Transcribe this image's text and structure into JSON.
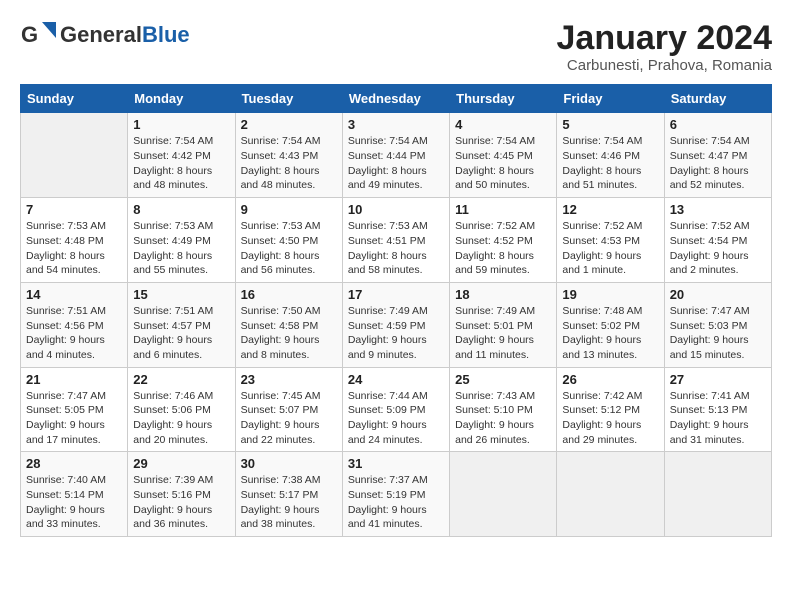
{
  "logo": {
    "line1": "General",
    "line2": "Blue",
    "tagline": ""
  },
  "title": "January 2024",
  "subtitle": "Carbunesti, Prahova, Romania",
  "days_header": [
    "Sunday",
    "Monday",
    "Tuesday",
    "Wednesday",
    "Thursday",
    "Friday",
    "Saturday"
  ],
  "weeks": [
    [
      {
        "num": "",
        "info": ""
      },
      {
        "num": "1",
        "info": "Sunrise: 7:54 AM\nSunset: 4:42 PM\nDaylight: 8 hours\nand 48 minutes."
      },
      {
        "num": "2",
        "info": "Sunrise: 7:54 AM\nSunset: 4:43 PM\nDaylight: 8 hours\nand 48 minutes."
      },
      {
        "num": "3",
        "info": "Sunrise: 7:54 AM\nSunset: 4:44 PM\nDaylight: 8 hours\nand 49 minutes."
      },
      {
        "num": "4",
        "info": "Sunrise: 7:54 AM\nSunset: 4:45 PM\nDaylight: 8 hours\nand 50 minutes."
      },
      {
        "num": "5",
        "info": "Sunrise: 7:54 AM\nSunset: 4:46 PM\nDaylight: 8 hours\nand 51 minutes."
      },
      {
        "num": "6",
        "info": "Sunrise: 7:54 AM\nSunset: 4:47 PM\nDaylight: 8 hours\nand 52 minutes."
      }
    ],
    [
      {
        "num": "7",
        "info": "Sunrise: 7:53 AM\nSunset: 4:48 PM\nDaylight: 8 hours\nand 54 minutes."
      },
      {
        "num": "8",
        "info": "Sunrise: 7:53 AM\nSunset: 4:49 PM\nDaylight: 8 hours\nand 55 minutes."
      },
      {
        "num": "9",
        "info": "Sunrise: 7:53 AM\nSunset: 4:50 PM\nDaylight: 8 hours\nand 56 minutes."
      },
      {
        "num": "10",
        "info": "Sunrise: 7:53 AM\nSunset: 4:51 PM\nDaylight: 8 hours\nand 58 minutes."
      },
      {
        "num": "11",
        "info": "Sunrise: 7:52 AM\nSunset: 4:52 PM\nDaylight: 8 hours\nand 59 minutes."
      },
      {
        "num": "12",
        "info": "Sunrise: 7:52 AM\nSunset: 4:53 PM\nDaylight: 9 hours\nand 1 minute."
      },
      {
        "num": "13",
        "info": "Sunrise: 7:52 AM\nSunset: 4:54 PM\nDaylight: 9 hours\nand 2 minutes."
      }
    ],
    [
      {
        "num": "14",
        "info": "Sunrise: 7:51 AM\nSunset: 4:56 PM\nDaylight: 9 hours\nand 4 minutes."
      },
      {
        "num": "15",
        "info": "Sunrise: 7:51 AM\nSunset: 4:57 PM\nDaylight: 9 hours\nand 6 minutes."
      },
      {
        "num": "16",
        "info": "Sunrise: 7:50 AM\nSunset: 4:58 PM\nDaylight: 9 hours\nand 8 minutes."
      },
      {
        "num": "17",
        "info": "Sunrise: 7:49 AM\nSunset: 4:59 PM\nDaylight: 9 hours\nand 9 minutes."
      },
      {
        "num": "18",
        "info": "Sunrise: 7:49 AM\nSunset: 5:01 PM\nDaylight: 9 hours\nand 11 minutes."
      },
      {
        "num": "19",
        "info": "Sunrise: 7:48 AM\nSunset: 5:02 PM\nDaylight: 9 hours\nand 13 minutes."
      },
      {
        "num": "20",
        "info": "Sunrise: 7:47 AM\nSunset: 5:03 PM\nDaylight: 9 hours\nand 15 minutes."
      }
    ],
    [
      {
        "num": "21",
        "info": "Sunrise: 7:47 AM\nSunset: 5:05 PM\nDaylight: 9 hours\nand 17 minutes."
      },
      {
        "num": "22",
        "info": "Sunrise: 7:46 AM\nSunset: 5:06 PM\nDaylight: 9 hours\nand 20 minutes."
      },
      {
        "num": "23",
        "info": "Sunrise: 7:45 AM\nSunset: 5:07 PM\nDaylight: 9 hours\nand 22 minutes."
      },
      {
        "num": "24",
        "info": "Sunrise: 7:44 AM\nSunset: 5:09 PM\nDaylight: 9 hours\nand 24 minutes."
      },
      {
        "num": "25",
        "info": "Sunrise: 7:43 AM\nSunset: 5:10 PM\nDaylight: 9 hours\nand 26 minutes."
      },
      {
        "num": "26",
        "info": "Sunrise: 7:42 AM\nSunset: 5:12 PM\nDaylight: 9 hours\nand 29 minutes."
      },
      {
        "num": "27",
        "info": "Sunrise: 7:41 AM\nSunset: 5:13 PM\nDaylight: 9 hours\nand 31 minutes."
      }
    ],
    [
      {
        "num": "28",
        "info": "Sunrise: 7:40 AM\nSunset: 5:14 PM\nDaylight: 9 hours\nand 33 minutes."
      },
      {
        "num": "29",
        "info": "Sunrise: 7:39 AM\nSunset: 5:16 PM\nDaylight: 9 hours\nand 36 minutes."
      },
      {
        "num": "30",
        "info": "Sunrise: 7:38 AM\nSunset: 5:17 PM\nDaylight: 9 hours\nand 38 minutes."
      },
      {
        "num": "31",
        "info": "Sunrise: 7:37 AM\nSunset: 5:19 PM\nDaylight: 9 hours\nand 41 minutes."
      },
      {
        "num": "",
        "info": ""
      },
      {
        "num": "",
        "info": ""
      },
      {
        "num": "",
        "info": ""
      }
    ]
  ]
}
